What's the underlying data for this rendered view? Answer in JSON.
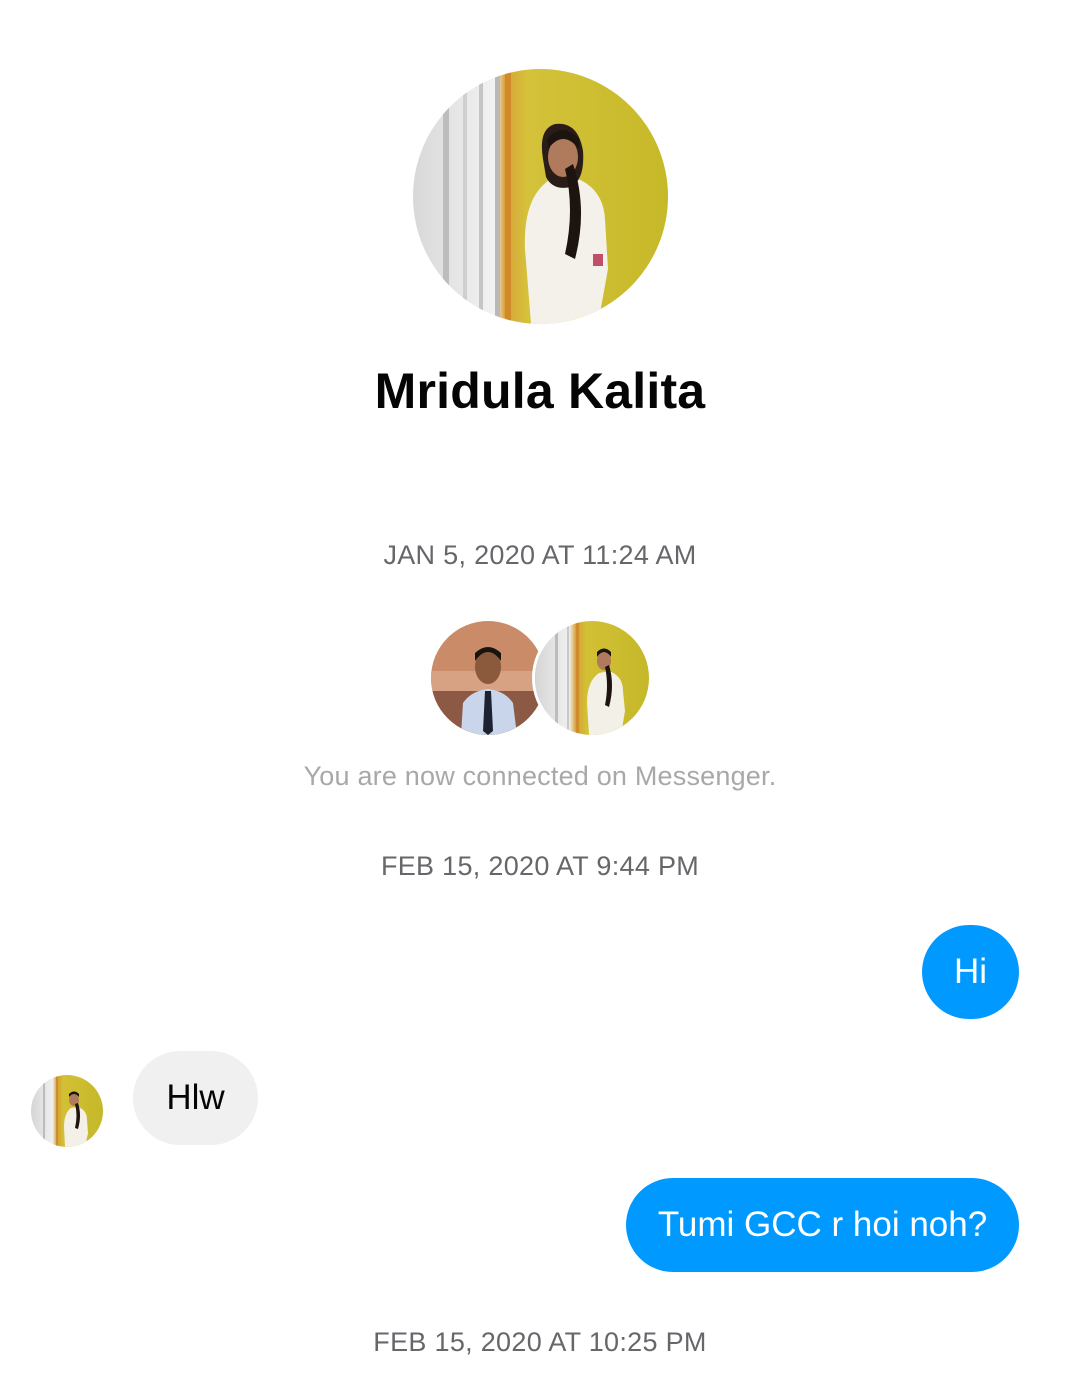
{
  "conversation": {
    "contact_name": "Mridula Kalita",
    "timestamps": [
      "JAN 5, 2020 AT 11:24 AM",
      "FEB 15, 2020 AT 9:44 PM",
      "FEB 15, 2020 AT 10:25 PM"
    ],
    "connected_note": "You are now connected on Messenger.",
    "messages": [
      {
        "direction": "outgoing",
        "text": "Hi"
      },
      {
        "direction": "incoming",
        "text": "Hlw"
      },
      {
        "direction": "outgoing",
        "text": "Tumi GCC r hoi noh?"
      }
    ]
  },
  "colors": {
    "outgoing_bubble": "#0099ff",
    "incoming_bubble": "#f0f0f0",
    "timestamp_text": "#65676b",
    "note_text": "#a8a8a8"
  },
  "icons": {
    "profile_avatar": "contact-photo",
    "self_avatar": "user-photo"
  }
}
